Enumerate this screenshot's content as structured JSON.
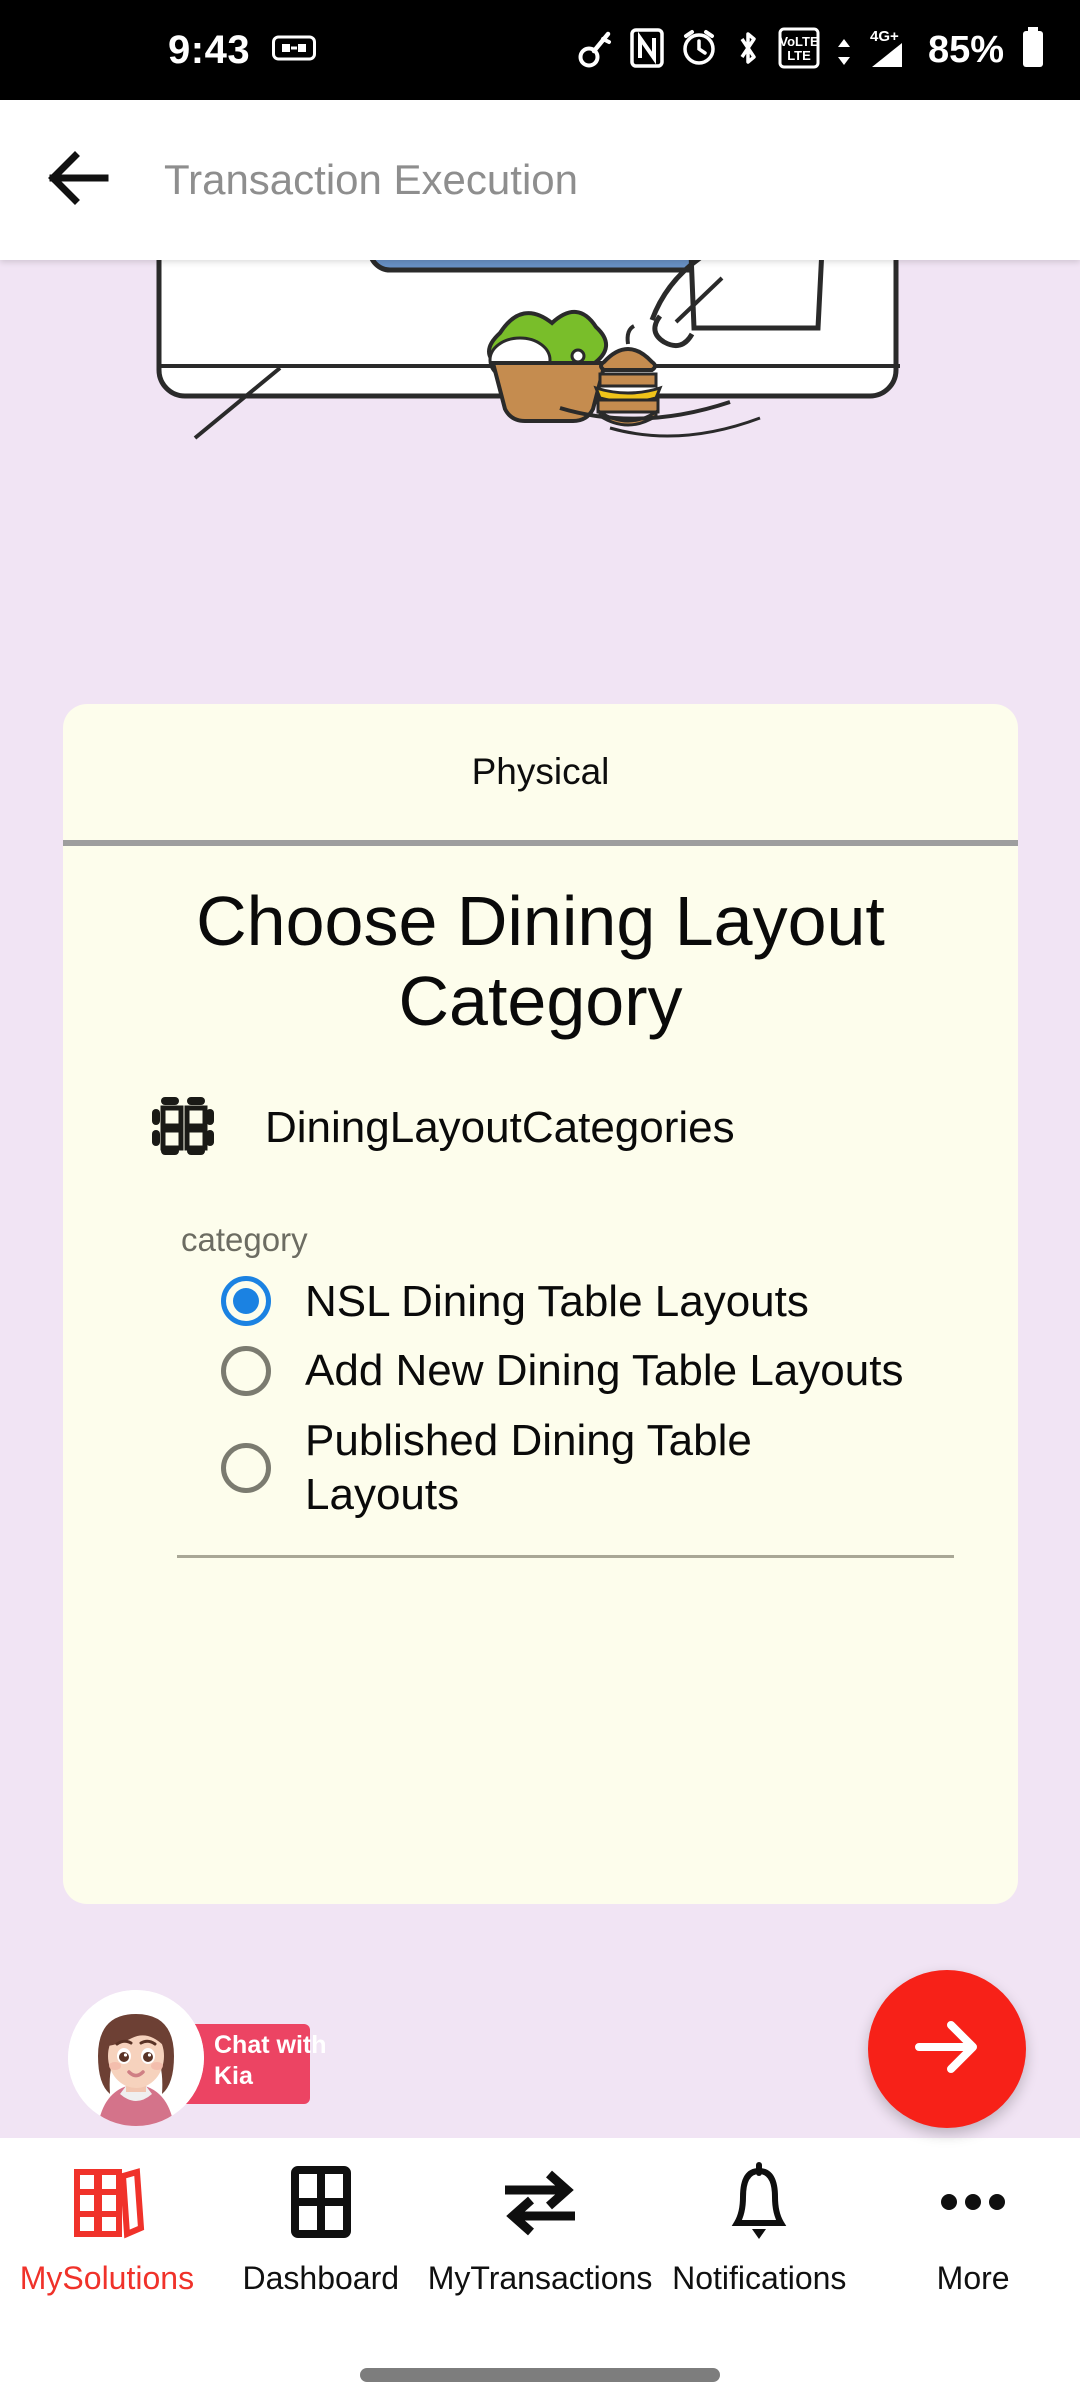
{
  "status_bar": {
    "time": "9:43",
    "battery_percent": "85%",
    "icons": [
      "split-screen-icon",
      "key-icon",
      "nfc-icon",
      "alarm-icon",
      "bluetooth-icon",
      "volte-icon",
      "signal-4g-plus-icon",
      "battery-icon"
    ]
  },
  "app_bar": {
    "back_icon": "back-arrow-icon",
    "title": "Transaction Execution"
  },
  "illustration": {
    "alt": "restaurant-dining-illustration"
  },
  "card": {
    "badge": "Physical",
    "title": "Choose Dining Layout Category",
    "entity_icon": "dining-table-layout-icon",
    "entity_name": "DiningLayoutCategories",
    "field_label": "category",
    "options": [
      {
        "label": "NSL Dining Table Layouts",
        "selected": true
      },
      {
        "label": "Add New Dining Table Layouts",
        "selected": false
      },
      {
        "label": "Published Dining Table Layouts",
        "selected": false
      }
    ]
  },
  "chat_widget": {
    "label": "Chat with Kia",
    "avatar": "kia-assistant-avatar",
    "accent_color": "#ec4463"
  },
  "fab": {
    "icon": "arrow-right-icon",
    "color": "#f72118"
  },
  "bottom_nav": {
    "active_color": "#f0322a",
    "items": [
      {
        "label": "MySolutions",
        "icon": "books-icon",
        "active": true
      },
      {
        "label": "Dashboard",
        "icon": "grid-icon",
        "active": false
      },
      {
        "label": "MyTransactions",
        "icon": "transfer-arrows-icon",
        "active": false
      },
      {
        "label": "Notifications",
        "icon": "bell-icon",
        "active": false
      },
      {
        "label": "More",
        "icon": "ellipsis-icon",
        "active": false
      }
    ]
  }
}
